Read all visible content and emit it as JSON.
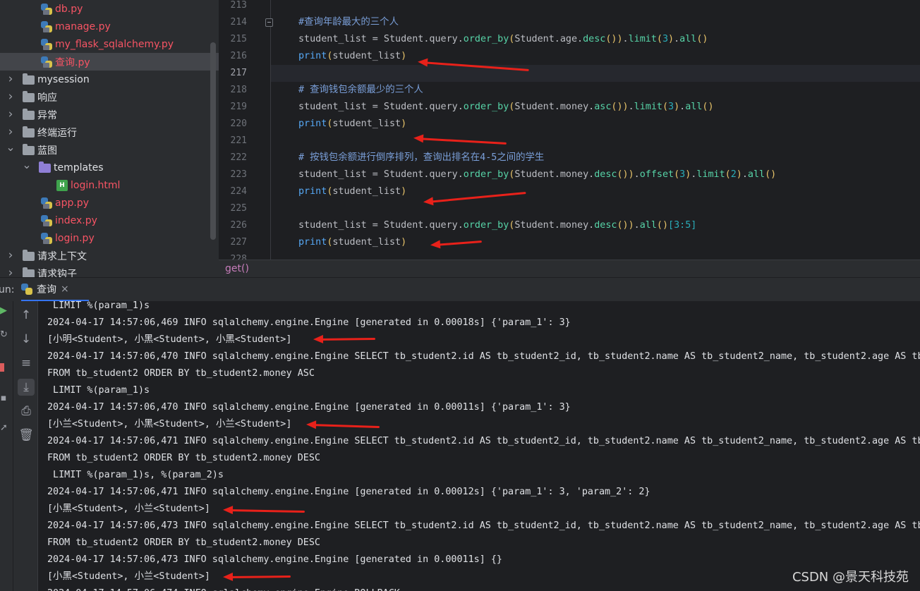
{
  "tree": {
    "items": [
      {
        "label": "db.py",
        "kind": "py",
        "indent": 3,
        "red": true
      },
      {
        "label": "manage.py",
        "kind": "py",
        "indent": 3,
        "red": true
      },
      {
        "label": "my_flask_sqlalchemy.py",
        "kind": "py",
        "indent": 3,
        "red": true
      },
      {
        "label": "查询.py",
        "kind": "py",
        "indent": 3,
        "red": true,
        "selected": true
      },
      {
        "label": "mysession",
        "kind": "folder",
        "indent": 0,
        "chevron": "right"
      },
      {
        "label": "响应",
        "kind": "folder",
        "indent": 0,
        "chevron": "right"
      },
      {
        "label": "异常",
        "kind": "folder",
        "indent": 0,
        "chevron": "right"
      },
      {
        "label": "终端运行",
        "kind": "folder",
        "indent": 0,
        "chevron": "right"
      },
      {
        "label": "蓝图",
        "kind": "folder",
        "indent": 0,
        "chevron": "down"
      },
      {
        "label": "templates",
        "kind": "folder-purple",
        "indent": 1,
        "chevron": "down"
      },
      {
        "label": "login.html",
        "kind": "html",
        "indent": 2,
        "red": true
      },
      {
        "label": "app.py",
        "kind": "py",
        "indent": 1,
        "red": true
      },
      {
        "label": "index.py",
        "kind": "py",
        "indent": 1,
        "red": true
      },
      {
        "label": "login.py",
        "kind": "py",
        "indent": 1,
        "red": true
      },
      {
        "label": "请求上下文",
        "kind": "folder",
        "indent": 0,
        "chevron": "right"
      },
      {
        "label": "请求钩子",
        "kind": "folder",
        "indent": 0,
        "chevron": "right"
      }
    ]
  },
  "editor": {
    "line_numbers": [
      "213",
      "214",
      "215",
      "216",
      "217",
      "218",
      "219",
      "220",
      "221",
      "222",
      "223",
      "224",
      "225",
      "226",
      "227",
      "228"
    ],
    "current_line": "217",
    "lines": [
      {
        "ln": 1,
        "parts": [
          [
            "cm",
            "#查询年龄最大的三个人"
          ]
        ]
      },
      {
        "ln": 2,
        "parts": [
          [
            "t",
            "student_list = Student.query."
          ],
          [
            "mt",
            "order_by"
          ],
          [
            "br",
            "("
          ],
          [
            "t",
            "Student.age."
          ],
          [
            "mt",
            "desc"
          ],
          [
            "br",
            "()"
          ],
          [
            "br",
            ")"
          ],
          [
            "t",
            "."
          ],
          [
            "mt",
            "limit"
          ],
          [
            "br",
            "("
          ],
          [
            "num",
            "3"
          ],
          [
            "br",
            ")"
          ],
          [
            "t",
            "."
          ],
          [
            "mt",
            "all"
          ],
          [
            "br",
            "()"
          ]
        ]
      },
      {
        "ln": 3,
        "parts": [
          [
            "fn",
            "print"
          ],
          [
            "br",
            "("
          ],
          [
            "t",
            "student_list"
          ],
          [
            "br",
            ")"
          ]
        ]
      },
      {
        "ln": 5,
        "parts": [
          [
            "cm",
            "# 查询钱包余额最少的三个人"
          ]
        ]
      },
      {
        "ln": 6,
        "parts": [
          [
            "t",
            "student_list = Student.query."
          ],
          [
            "mt",
            "order_by"
          ],
          [
            "br",
            "("
          ],
          [
            "t",
            "Student.money."
          ],
          [
            "mt",
            "asc"
          ],
          [
            "br",
            "()"
          ],
          [
            "br",
            ")"
          ],
          [
            "t",
            "."
          ],
          [
            "mt",
            "limit"
          ],
          [
            "br",
            "("
          ],
          [
            "num",
            "3"
          ],
          [
            "br",
            ")"
          ],
          [
            "t",
            "."
          ],
          [
            "mt",
            "all"
          ],
          [
            "br",
            "()"
          ]
        ]
      },
      {
        "ln": 7,
        "parts": [
          [
            "fn",
            "print"
          ],
          [
            "br",
            "("
          ],
          [
            "t",
            "student_list"
          ],
          [
            "br",
            ")"
          ]
        ]
      },
      {
        "ln": 9,
        "parts": [
          [
            "cm",
            "# 按钱包余额进行倒序排列，查询出排名在4-5之间的学生"
          ]
        ]
      },
      {
        "ln": 10,
        "parts": [
          [
            "t",
            "student_list = Student.query."
          ],
          [
            "mt",
            "order_by"
          ],
          [
            "br",
            "("
          ],
          [
            "t",
            "Student.money."
          ],
          [
            "mt",
            "desc"
          ],
          [
            "br",
            "()"
          ],
          [
            "br",
            ")"
          ],
          [
            "t",
            "."
          ],
          [
            "mt",
            "offset"
          ],
          [
            "br",
            "("
          ],
          [
            "num",
            "3"
          ],
          [
            "br",
            ")"
          ],
          [
            "t",
            "."
          ],
          [
            "mt",
            "limit"
          ],
          [
            "br",
            "("
          ],
          [
            "num",
            "2"
          ],
          [
            "br",
            ")"
          ],
          [
            "t",
            "."
          ],
          [
            "mt",
            "all"
          ],
          [
            "br",
            "()"
          ]
        ]
      },
      {
        "ln": 11,
        "parts": [
          [
            "fn",
            "print"
          ],
          [
            "br",
            "("
          ],
          [
            "t",
            "student_list"
          ],
          [
            "br",
            ")"
          ]
        ]
      },
      {
        "ln": 13,
        "parts": [
          [
            "t",
            "student_list = Student.query."
          ],
          [
            "mt",
            "order_by"
          ],
          [
            "br",
            "("
          ],
          [
            "t",
            "Student.money."
          ],
          [
            "mt",
            "desc"
          ],
          [
            "br",
            "()"
          ],
          [
            "br",
            ")"
          ],
          [
            "t",
            "."
          ],
          [
            "mt",
            "all"
          ],
          [
            "br",
            "()"
          ],
          [
            "num",
            "[3:5]"
          ]
        ]
      },
      {
        "ln": 14,
        "parts": [
          [
            "fn",
            "print"
          ],
          [
            "br",
            "("
          ],
          [
            "t",
            "student_list"
          ],
          [
            "br",
            ")"
          ]
        ]
      }
    ],
    "hint": "get()"
  },
  "run": {
    "label": "un:",
    "tab": "查询",
    "close": "×"
  },
  "console": {
    "lines": [
      " LIMIT %(param_1)s",
      "2024-04-17 14:57:06,469 INFO sqlalchemy.engine.Engine [generated in 0.00018s] {'param_1': 3}",
      "[小明<Student>, 小黑<Student>, 小黑<Student>]",
      "2024-04-17 14:57:06,470 INFO sqlalchemy.engine.Engine SELECT tb_student2.id AS tb_student2_id, tb_student2.name AS tb_student2_name, tb_student2.age AS tb_st",
      "FROM tb_student2 ORDER BY tb_student2.money ASC",
      " LIMIT %(param_1)s",
      "2024-04-17 14:57:06,470 INFO sqlalchemy.engine.Engine [generated in 0.00011s] {'param_1': 3}",
      "[小兰<Student>, 小黑<Student>, 小兰<Student>]",
      "2024-04-17 14:57:06,471 INFO sqlalchemy.engine.Engine SELECT tb_student2.id AS tb_student2_id, tb_student2.name AS tb_student2_name, tb_student2.age AS tb_st",
      "FROM tb_student2 ORDER BY tb_student2.money DESC",
      " LIMIT %(param_1)s, %(param_2)s",
      "2024-04-17 14:57:06,471 INFO sqlalchemy.engine.Engine [generated in 0.00012s] {'param_1': 3, 'param_2': 2}",
      "[小黑<Student>, 小兰<Student>]",
      "2024-04-17 14:57:06,473 INFO sqlalchemy.engine.Engine SELECT tb_student2.id AS tb_student2_id, tb_student2.name AS tb_student2_name, tb_student2.age AS tb_st",
      "FROM tb_student2 ORDER BY tb_student2.money DESC",
      "2024-04-17 14:57:06,473 INFO sqlalchemy.engine.Engine [generated in 0.00011s] {}",
      "[小黑<Student>, 小兰<Student>]",
      "2024-04-17 14:57:06,474 INFO sqlalchemy.engine.Engine ROLLBACK"
    ]
  },
  "tools": {
    "side": [
      "arrow-up-icon",
      "arrow-down-icon",
      "soft-wrap-icon",
      "scroll-to-end-icon",
      "print-icon",
      "trash-icon"
    ]
  },
  "watermark": "CSDN @景天科技苑",
  "colors": {
    "annotation_arrow": "#e8211a",
    "selection": "#43454a",
    "accent": "#3574f0"
  }
}
